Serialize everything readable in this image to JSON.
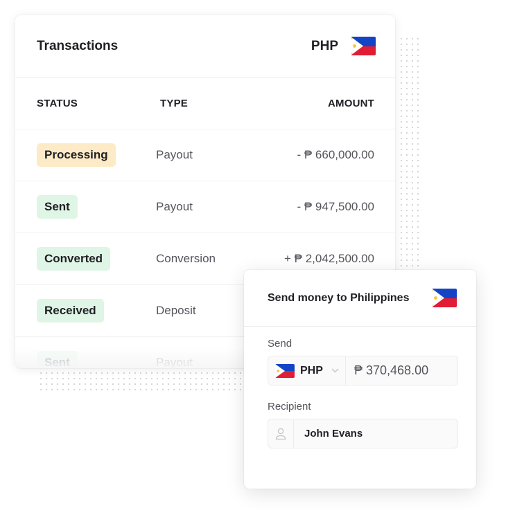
{
  "colors": {
    "processing_bg": "#fdebc8",
    "success_bg": "#dff5e6",
    "flag_blue": "#1444c6",
    "flag_red": "#e11d35",
    "flag_sun": "#f6c543"
  },
  "transactions": {
    "title": "Transactions",
    "currency_code": "PHP",
    "currency_flag": "philippines-flag",
    "columns": {
      "status": "STATUS",
      "type": "TYPE",
      "amount": "AMOUNT"
    },
    "rows": [
      {
        "status": "Processing",
        "status_kind": "processing",
        "type": "Payout",
        "amount": "- ₱ 660,000.00"
      },
      {
        "status": "Sent",
        "status_kind": "success",
        "type": "Payout",
        "amount": "- ₱ 947,500.00"
      },
      {
        "status": "Converted",
        "status_kind": "success",
        "type": "Conversion",
        "amount": "+ ₱ 2,042,500.00"
      },
      {
        "status": "Received",
        "status_kind": "success",
        "type": "Deposit",
        "amount": ""
      },
      {
        "status": "Sent",
        "status_kind": "success",
        "type": "Payout",
        "amount": ""
      }
    ]
  },
  "send_money": {
    "title": "Send money to Philippines",
    "flag": "philippines-flag",
    "send_label": "Send",
    "currency_code": "PHP",
    "amount_value": "₱ 370,468.00",
    "recipient_label": "Recipient",
    "recipient_value": "John Evans"
  }
}
